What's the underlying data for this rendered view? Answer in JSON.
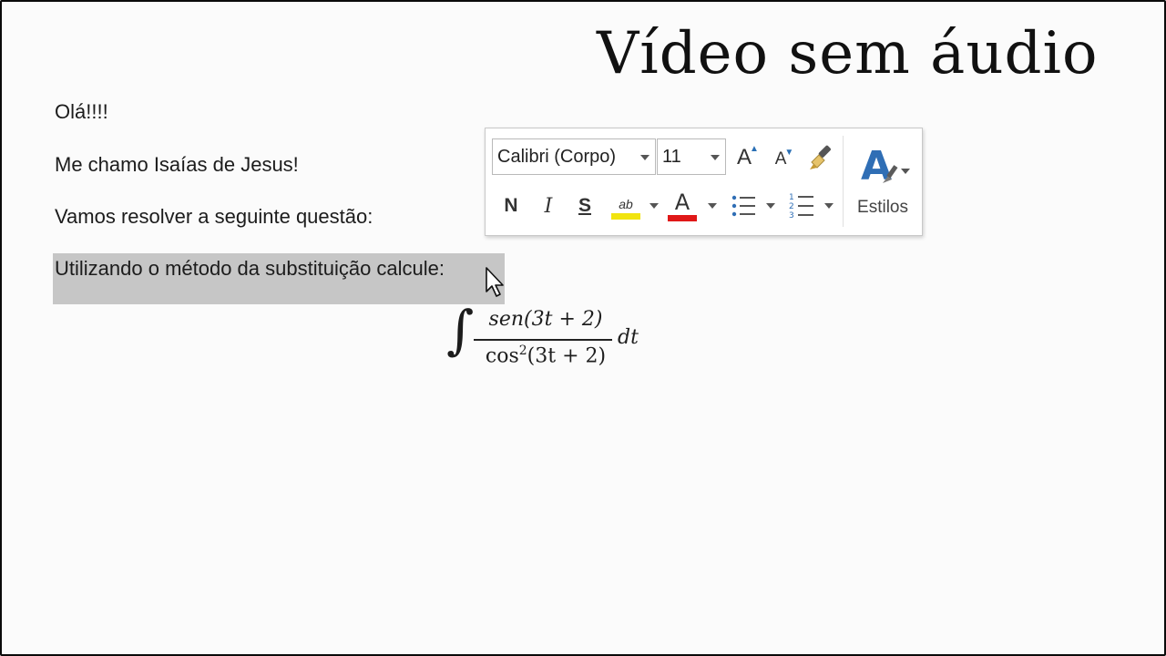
{
  "overlay": {
    "title": "Vídeo sem áudio"
  },
  "document": {
    "lines": [
      "Olá!!!!",
      "Me chamo Isaías de Jesus!",
      "Vamos resolver a seguinte questão:",
      "Utilizando o método da substituição calcule:"
    ],
    "formula": {
      "integral_sign": "∫",
      "numerator": "sen(3t + 2)",
      "denominator_base": "cos",
      "denominator_exp": "2",
      "denominator_arg": "(3t + 2)",
      "differential": "dt"
    }
  },
  "mini_toolbar": {
    "font_name": "Calibri (Corpo)",
    "font_size": "11",
    "grow_font_label": "A",
    "shrink_font_label": "A",
    "bold_label": "N",
    "italic_label": "I",
    "underline_label": "S",
    "highlight_label": "ab",
    "font_color_label": "A",
    "styles_label": "Estilos",
    "highlight_color": "#f1e40f",
    "font_color": "#e01818",
    "accent": "#2f6eb5"
  }
}
